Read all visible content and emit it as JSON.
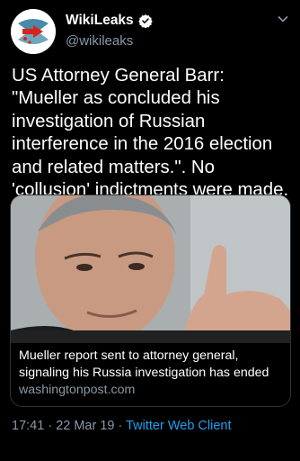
{
  "author": {
    "name": "WikiLeaks",
    "handle": "@wikileaks",
    "verified_icon": "verified-badge-icon",
    "avatar_icon": "wikileaks-hourglass-logo"
  },
  "tweet": {
    "text": "US Attorney General Barr: \"Mueller as concluded his investigation of Russian interference in the 2016 election and related matters.\". No 'collusion' indictments were made."
  },
  "link_card": {
    "image_desc": "photo-of-robert-mueller",
    "title": "Mueller report sent to attorney general, signaling his Russia investigation has ended",
    "domain": "washingtonpost.com"
  },
  "meta": {
    "time": "17:41",
    "separator": " · ",
    "date": "22 Mar 19",
    "client": "Twitter Web Client"
  },
  "colors": {
    "background": "#000000",
    "secondary_text": "#8899a6",
    "link_blue": "#1da1f2",
    "card_border": "#2f3336"
  }
}
